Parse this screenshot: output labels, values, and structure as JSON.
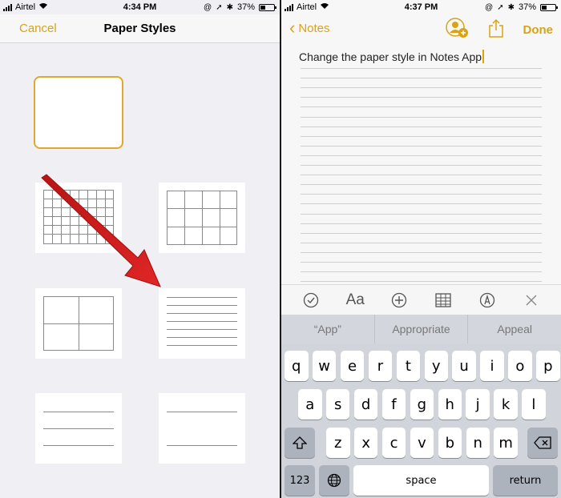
{
  "left_screen": {
    "status": {
      "carrier": "Airtel",
      "time": "4:34 PM",
      "battery": "37%"
    },
    "nav": {
      "cancel": "Cancel",
      "title": "Paper Styles"
    },
    "paper_styles": [
      {
        "name": "blank",
        "selected": true
      },
      {
        "name": "small-grid",
        "selected": false
      },
      {
        "name": "large-grid",
        "selected": false
      },
      {
        "name": "large-squares",
        "selected": false
      },
      {
        "name": "narrow-lines",
        "selected": false
      },
      {
        "name": "medium-lines",
        "selected": false
      },
      {
        "name": "wide-lines",
        "selected": false
      }
    ],
    "annotation": {
      "icon": "red-arrow",
      "color": "#d81e1e",
      "points_to": "narrow-lines"
    }
  },
  "right_screen": {
    "status": {
      "carrier": "Airtel",
      "time": "4:37 PM",
      "battery": "37%"
    },
    "nav": {
      "back": "Notes",
      "done": "Done",
      "icons": [
        "add-person-icon",
        "share-icon"
      ]
    },
    "note": {
      "text": "Change the paper style in Notes App"
    },
    "toolbar": [
      "checklist-icon",
      "Aa",
      "add-icon",
      "table-icon",
      "sketch-icon",
      "close-icon"
    ],
    "suggestions": [
      "“App”",
      "Appropriate",
      "Appeal"
    ],
    "keyboard": {
      "row1": [
        "q",
        "w",
        "e",
        "r",
        "t",
        "y",
        "u",
        "i",
        "o",
        "p"
      ],
      "row2": [
        "a",
        "s",
        "d",
        "f",
        "g",
        "h",
        "j",
        "k",
        "l"
      ],
      "row3": [
        "z",
        "x",
        "c",
        "v",
        "b",
        "n",
        "m"
      ],
      "numbers": "123",
      "space": "space",
      "return": "return"
    }
  },
  "colors": {
    "accent": "#d9a314",
    "selected_border": "#e0a92c",
    "keyboard_bg": "#d1d5db"
  }
}
